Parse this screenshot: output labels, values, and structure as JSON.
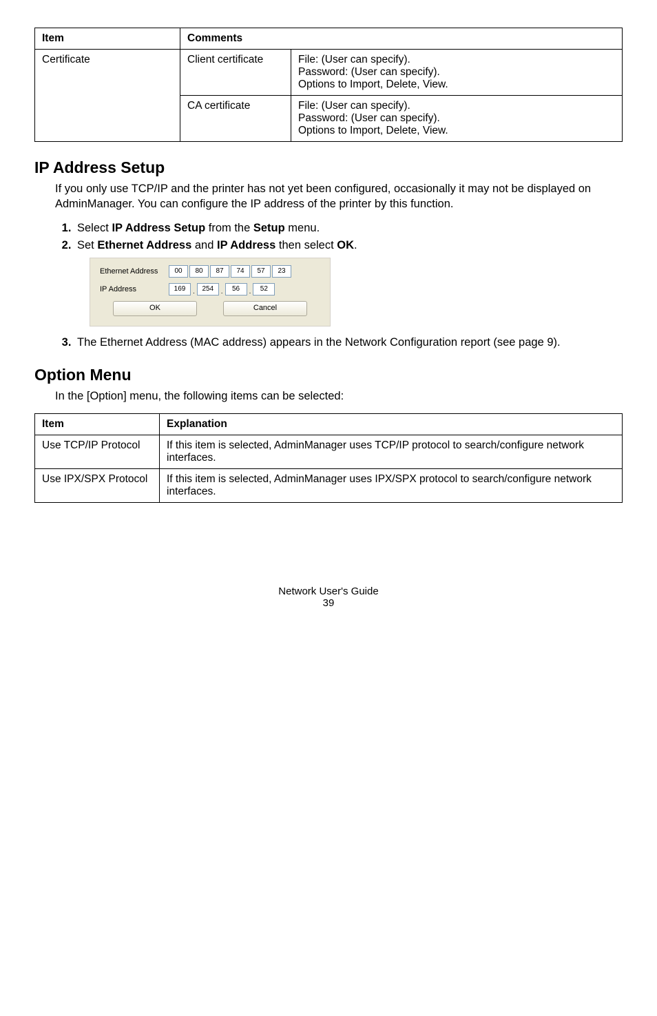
{
  "table1": {
    "headers": [
      "Item",
      "Comments"
    ],
    "row_item": "Certificate",
    "client_label": "Client certificate",
    "client_text": "File: (User can specify).\nPassword: (User can specify).\nOptions to Import, Delete, View.",
    "ca_label": "CA certificate",
    "ca_text": "File: (User can specify).\nPassword: (User can specify).\nOptions to Import, Delete, View."
  },
  "section1": {
    "title": "IP Address Setup",
    "body": "If you only use TCP/IP and the printer has not yet been configured, occasionally it may not be displayed on AdminManager. You can configure the IP address of the printer by this function.",
    "step1_pre": "Select ",
    "step1_bold1": "IP Address Setup",
    "step1_mid": " from the ",
    "step1_bold2": "Setup",
    "step1_end": " menu.",
    "step2_pre": "Set ",
    "step2_bold1": "Ethernet Address",
    "step2_mid": " and ",
    "step2_bold2": "IP Address",
    "step2_mid2": " then select ",
    "step2_bold3": "OK",
    "step2_end": ".",
    "step3": "The Ethernet Address (MAC address) appears in the Network Configuration report (see page 9)."
  },
  "ui": {
    "eth_label": "Ethernet Address",
    "eth": [
      "00",
      "80",
      "87",
      "74",
      "57",
      "23"
    ],
    "ip_label": "IP Address",
    "ip": [
      "169",
      "254",
      "56",
      "52"
    ],
    "ok": "OK",
    "cancel": "Cancel"
  },
  "section2": {
    "title": "Option Menu",
    "body": "In the [Option] menu, the following items can be selected:"
  },
  "table2": {
    "headers": [
      "Item",
      "Explanation"
    ],
    "rows": [
      {
        "item": "Use TCP/IP Protocol",
        "exp": "If this item is selected, AdminManager uses TCP/IP protocol to search/configure network interfaces."
      },
      {
        "item": "Use IPX/SPX Protocol",
        "exp": "If this item is selected, AdminManager uses IPX/SPX protocol to search/configure network interfaces."
      }
    ]
  },
  "footer": {
    "title": "Network User's Guide",
    "page": "39"
  }
}
